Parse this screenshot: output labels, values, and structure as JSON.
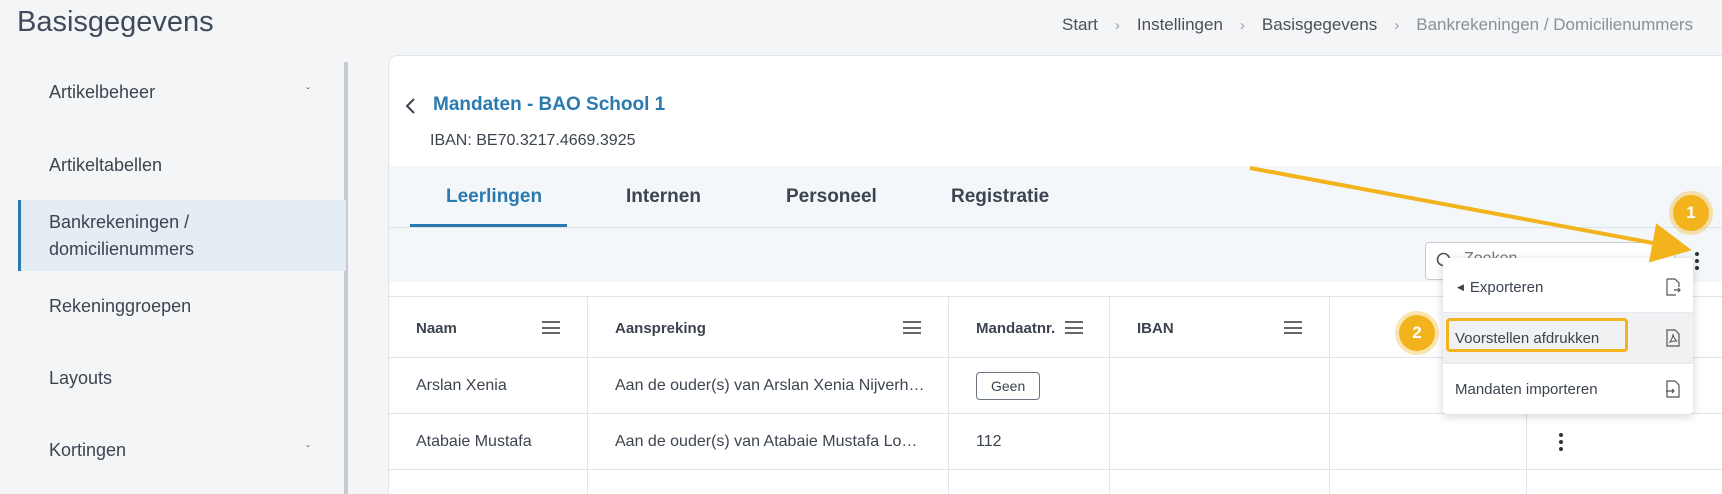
{
  "page": {
    "title": "Basisgegevens"
  },
  "breadcrumb": {
    "items": [
      "Start",
      "Instellingen",
      "Basisgegevens",
      "Bankrekeningen / Domicilienummers"
    ],
    "separator": "›"
  },
  "sidebar": {
    "items": [
      {
        "label": "Artikelbeheer",
        "has_children": true
      },
      {
        "label": "Artikeltabellen",
        "has_children": false
      },
      {
        "label_line1": "Bankrekeningen /",
        "label_line2": "domicilienummers",
        "active": true
      },
      {
        "label": "Rekeninggroepen",
        "has_children": false
      },
      {
        "label": "Layouts",
        "has_children": false
      },
      {
        "label": "Kortingen",
        "has_children": true
      }
    ]
  },
  "card": {
    "title": "Mandaten - BAO School 1",
    "iban": "IBAN: BE70.3217.4669.3925"
  },
  "tabs": [
    {
      "label": "Leerlingen",
      "active": true
    },
    {
      "label": "Internen"
    },
    {
      "label": "Personeel"
    },
    {
      "label": "Registratie"
    }
  ],
  "search": {
    "placeholder": "Zoeken"
  },
  "table": {
    "columns": [
      "Naam",
      "Aanspreking",
      "Mandaatnr.",
      "IBAN"
    ],
    "rows": [
      {
        "naam": "Arslan Xenia",
        "aanspreking": "Aan de ouder(s) van Arslan Xenia Nijverh…",
        "mandaatnr": "Geen",
        "mandaat_is_badge": true,
        "iban": ""
      },
      {
        "naam": "Atabaie Mustafa",
        "aanspreking": "Aan de ouder(s) van Atabaie Mustafa Lo…",
        "mandaatnr": "112",
        "iban": ""
      }
    ]
  },
  "dropdown": {
    "items": [
      {
        "label": "Exporteren",
        "icon": "file-export-icon",
        "has_submenu": true
      },
      {
        "label": "Voorstellen afdrukken",
        "icon": "pdf-file-icon",
        "highlighted": true
      },
      {
        "label": "Mandaten importeren",
        "icon": "file-import-icon"
      }
    ]
  },
  "callouts": [
    "1",
    "2"
  ],
  "colors": {
    "accent": "#2a7ab0",
    "highlight": "#f2b31c"
  }
}
